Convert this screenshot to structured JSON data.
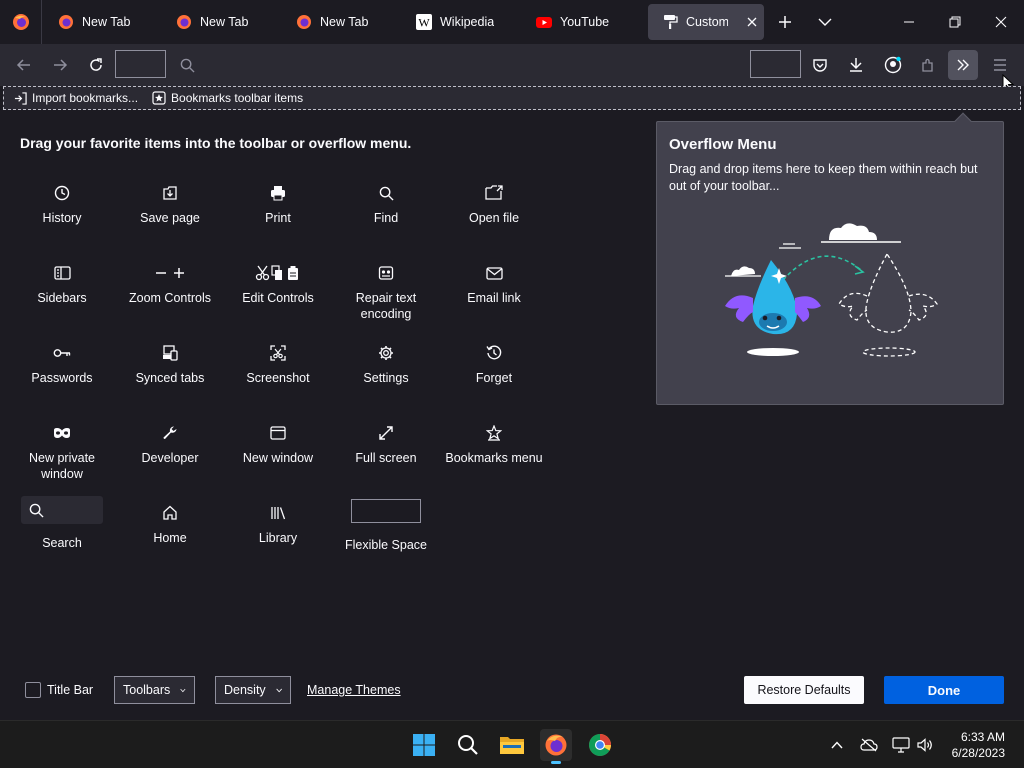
{
  "tabs": [
    {
      "label": "New Tab",
      "icon": "firefox-icon"
    },
    {
      "label": "New Tab",
      "icon": "firefox-icon"
    },
    {
      "label": "New Tab",
      "icon": "firefox-icon"
    },
    {
      "label": "Wikipedia",
      "icon": "wikipedia-icon"
    },
    {
      "label": "YouTube",
      "icon": "youtube-icon"
    },
    {
      "label": "Customize |",
      "icon": "paint-roller-icon",
      "selected": true
    }
  ],
  "bookmarks_toolbar": {
    "import_label": "Import bookmarks...",
    "items_label": "Bookmarks toolbar items"
  },
  "palette": {
    "heading": "Drag your favorite items into the toolbar or overflow menu.",
    "items": [
      {
        "label": "History",
        "icon": "clock-icon"
      },
      {
        "label": "Save page",
        "icon": "save-page-icon"
      },
      {
        "label": "Print",
        "icon": "printer-icon"
      },
      {
        "label": "Find",
        "icon": "search-icon"
      },
      {
        "label": "Open file",
        "icon": "open-folder-icon"
      },
      {
        "label": "Sidebars",
        "icon": "sidebar-icon"
      },
      {
        "label": "Zoom Controls",
        "icon": "zoom-controls-icon"
      },
      {
        "label": "Edit Controls",
        "icon": "edit-controls-icon"
      },
      {
        "label": "Repair text encoding",
        "icon": "text-encoding-icon"
      },
      {
        "label": "Email link",
        "icon": "envelope-icon"
      },
      {
        "label": "Passwords",
        "icon": "key-icon"
      },
      {
        "label": "Synced tabs",
        "icon": "synced-tabs-icon"
      },
      {
        "label": "Screenshot",
        "icon": "screenshot-icon"
      },
      {
        "label": "Settings",
        "icon": "gear-icon"
      },
      {
        "label": "Forget",
        "icon": "forget-icon"
      },
      {
        "label": "New private window",
        "icon": "mask-icon"
      },
      {
        "label": "Developer",
        "icon": "wrench-icon"
      },
      {
        "label": "New window",
        "icon": "window-icon"
      },
      {
        "label": "Full screen",
        "icon": "fullscreen-icon"
      },
      {
        "label": "Bookmarks menu",
        "icon": "bookmark-star-icon"
      },
      {
        "label": "Search",
        "icon": "search-icon"
      },
      {
        "label": "Home",
        "icon": "home-icon"
      },
      {
        "label": "Library",
        "icon": "library-icon"
      },
      {
        "label": "Flexible Space",
        "icon": "flexible-space"
      }
    ]
  },
  "overflow": {
    "title": "Overflow Menu",
    "description": "Drag and drop items here to keep them within reach but out of your toolbar..."
  },
  "bottom": {
    "title_bar_label": "Title Bar",
    "toolbars_label": "Toolbars",
    "density_label": "Density",
    "manage_themes_label": "Manage Themes",
    "restore_defaults_label": "Restore Defaults",
    "done_label": "Done"
  },
  "taskbar": {
    "time": "6:33 AM",
    "date": "6/28/2023"
  },
  "colors": {
    "background": "#1c1b22",
    "toolbar": "#2b2a33",
    "panel": "#42414d",
    "accent": "#0061e0"
  }
}
